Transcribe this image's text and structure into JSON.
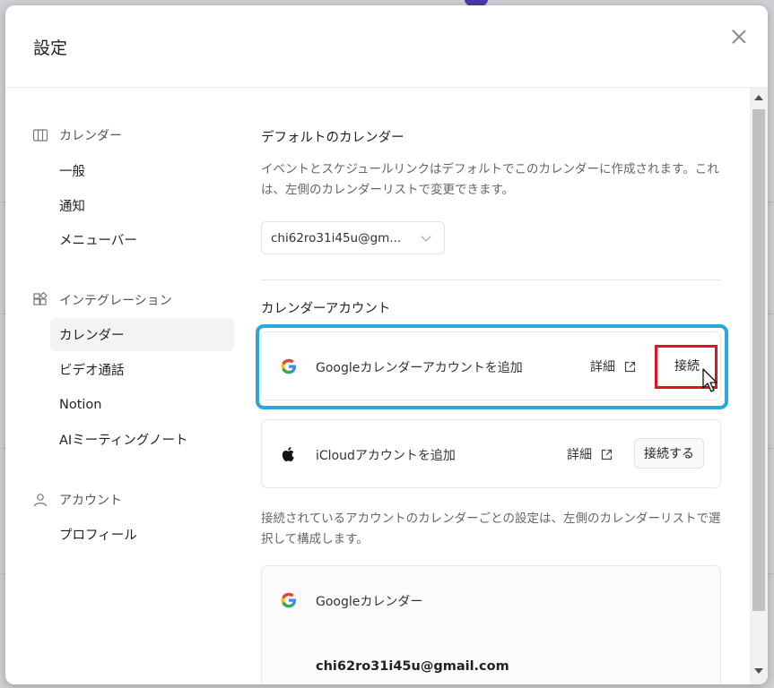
{
  "dialog": {
    "title": "設定"
  },
  "sidebar": {
    "sections": [
      {
        "title": "カレンダー",
        "icon": "calendar-columns-icon",
        "items": [
          "一般",
          "通知",
          "メニューバー"
        ]
      },
      {
        "title": "インテグレーション",
        "icon": "integrations-grid-icon",
        "items": [
          "カレンダー",
          "ビデオ通話",
          "Notion",
          "AIミーティングノート"
        ]
      },
      {
        "title": "アカウント",
        "icon": "person-icon",
        "items": [
          "プロフィール"
        ]
      }
    ],
    "active_item": "カレンダー"
  },
  "main": {
    "default_calendar": {
      "heading": "デフォルトのカレンダー",
      "description": "イベントとスケジュールリンクはデフォルトでこのカレンダーに作成されます。これは、左側のカレンダーリストで変更できます。",
      "selected_value": "chi62ro31i45u@gm..."
    },
    "calendar_accounts": {
      "heading": "カレンダーアカウント",
      "cards": [
        {
          "icon": "google-logo-icon",
          "label": "Googleカレンダーアカウントを追加",
          "detail": "詳細",
          "button": "接続"
        },
        {
          "icon": "apple-logo-icon",
          "label": "iCloudアカウントを追加",
          "detail": "詳細",
          "button": "接続する"
        }
      ],
      "note": "接続されているアカウントのカレンダーごとの設定は、左側のカレンダーリストで選択して構成します。",
      "connected": {
        "icon": "google-logo-icon",
        "label": "Googleカレンダー",
        "email": "chi62ro31i45u@gmail.com"
      }
    }
  },
  "colors": {
    "highlight_blue": "#28a8dd",
    "highlight_red": "#e0141e"
  }
}
